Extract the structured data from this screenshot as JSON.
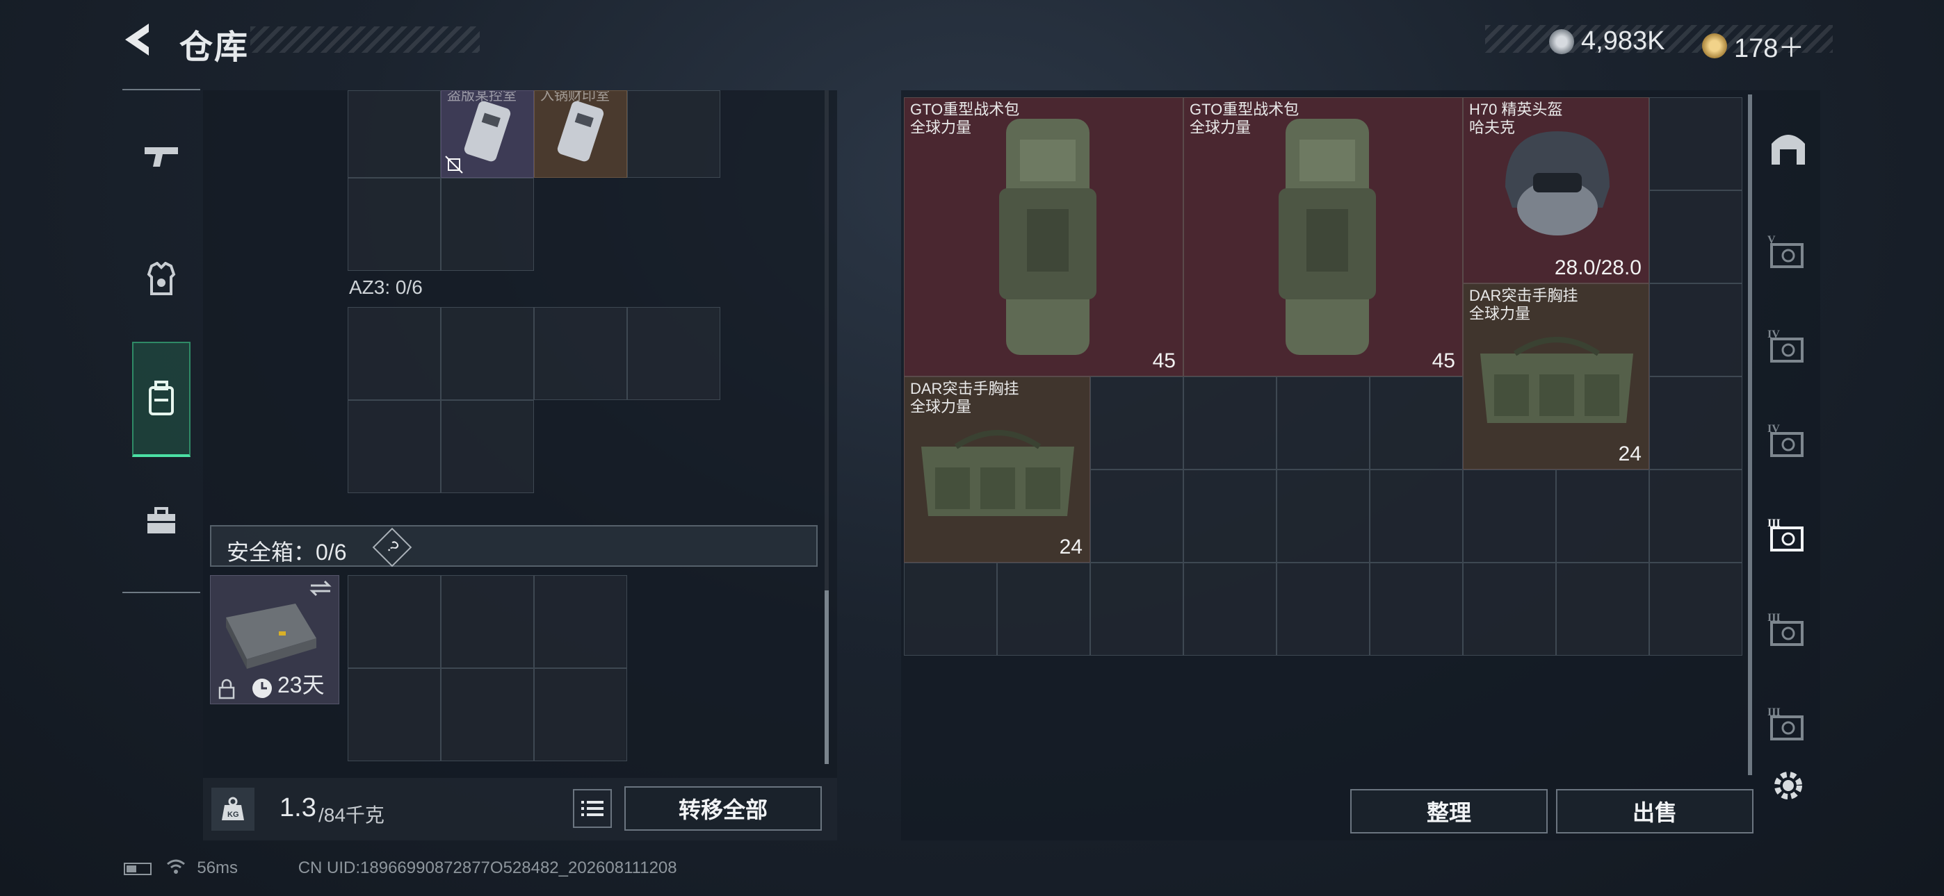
{
  "header": {
    "title": "仓库",
    "money": "4,983K",
    "coupons": "178＋"
  },
  "nav": {
    "items": [
      "weapon",
      "armor",
      "backpack",
      "medkit"
    ],
    "active_index": 2
  },
  "left": {
    "top_item_labels": [
      "盗版某控室",
      "入锅财印室"
    ],
    "az3_label": "AZ3: 0/6",
    "safe_box_label": "安全箱：0/6",
    "safe_box_help": "?",
    "safe_box_days": "23天",
    "weight_value": "1.3",
    "weight_capacity": "/84千克",
    "transfer_all_label": "转移全部"
  },
  "right": {
    "items": [
      {
        "name1": "GTO重型战术包",
        "name2": "全球力量",
        "value": "45"
      },
      {
        "name1": "GTO重型战术包",
        "name2": "全球力量",
        "value": "45"
      },
      {
        "name1": "H70 精英头盔",
        "name2": "哈夫克",
        "value": "28.0/28.0"
      },
      {
        "name1": "DAR突击手胸挂",
        "name2": "全球力量",
        "value": "24"
      },
      {
        "name1": "DAR突击手胸挂",
        "name2": "全球力量",
        "value": "24"
      }
    ],
    "sort_label": "整理",
    "sell_label": "出售",
    "tier_labels": [
      "V",
      "IV",
      "IV",
      "III",
      "III",
      "III"
    ]
  },
  "status": {
    "ping": "56ms",
    "uid": "CN UID:18966990872877O528482_202608111208"
  },
  "colors": {
    "accent": "#4be0a4",
    "item_red": "#4a2730",
    "item_brown": "#40352d"
  }
}
